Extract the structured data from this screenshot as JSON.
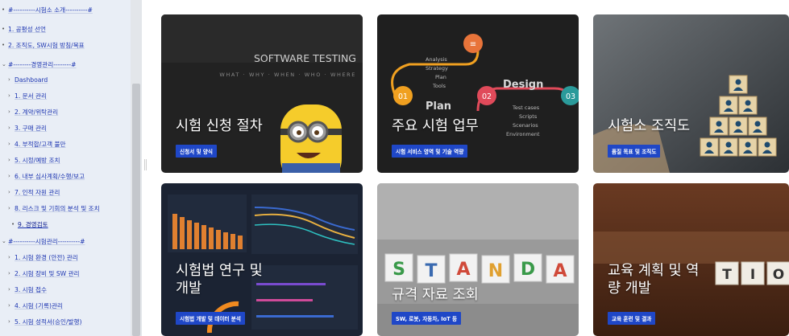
{
  "sidebar": {
    "items": [
      {
        "mark": "•",
        "label": "#----------시험소 소개----------#"
      },
      {
        "mark": "•",
        "label": "1. 공평성 선언"
      },
      {
        "mark": "•",
        "label": "2. 조직도, SW시험 방침/목표"
      },
      {
        "mark": "⌄",
        "label": "#--------경영관리--------#"
      },
      {
        "mark": "›",
        "label": "Dashboard"
      },
      {
        "mark": "›",
        "label": "1. 문서 관리"
      },
      {
        "mark": "›",
        "label": "2. 계약/위탁관리"
      },
      {
        "mark": "›",
        "label": "3. 구매 관리"
      },
      {
        "mark": "›",
        "label": "4. 부적합/고객 불만"
      },
      {
        "mark": "›",
        "label": "5. 시정/예방 조치"
      },
      {
        "mark": "›",
        "label": "6. 내부 심사계획/수행/보고"
      },
      {
        "mark": "›",
        "label": "7. 인적 자원 관리"
      },
      {
        "mark": "›",
        "label": "8. 리스크 및 기회의 분석 및 조치"
      },
      {
        "mark": "•",
        "label": "9. 경영검토"
      },
      {
        "mark": "⌄",
        "label": "#----------시험관리----------#"
      },
      {
        "mark": "›",
        "label": "1. 시험 환경 (안전) 관리"
      },
      {
        "mark": "›",
        "label": "2. 시험 장비 및 SW 관리"
      },
      {
        "mark": "›",
        "label": "3. 시험 접수"
      },
      {
        "mark": "›",
        "label": "4. 시험 (기록)관리"
      },
      {
        "mark": "›",
        "label": "5. 시험 성적서(승인/발행)"
      }
    ]
  },
  "cards": [
    {
      "title": "시험 신청 절차",
      "badge": "신청서 및 양식",
      "art": {
        "heading": "SOFTWARE TESTING",
        "sub": "WHAT · WHY · WHEN · WHO · WHERE"
      }
    },
    {
      "title": "주요 시험 업무",
      "badge": "시험 서비스 영역 및 기술 역량",
      "art": {
        "plan_items": [
          "Analysis",
          "Strategy",
          "Plan",
          "Tools"
        ],
        "plan": "Plan",
        "design": "Design",
        "design_items": [
          "Test cases",
          "Scripts",
          "Scenarios",
          "Environment"
        ],
        "steps": [
          "01",
          "02",
          "03"
        ]
      }
    },
    {
      "title": "시험소 조직도",
      "badge": "품질 목표 및 조직도"
    },
    {
      "title": "시험법 연구 및\n개발",
      "badge": "시험법 개발 및 데이터 분석"
    },
    {
      "title": "규격 자료 조회",
      "badge": "SW, 로봇, 자동차, IoT 등",
      "art": {
        "letters": [
          "S",
          "T",
          "A",
          "N",
          "D",
          "A"
        ]
      }
    },
    {
      "title": "교육 계획 및 역\n량 개발",
      "badge": "교육 훈련 및 결과",
      "art": {
        "letters": [
          "T",
          "I",
          "O"
        ]
      }
    }
  ],
  "colors": {
    "badge": "#1f47c7",
    "sidebar_bg": "#e9eef6",
    "link": "#1a33b0"
  }
}
